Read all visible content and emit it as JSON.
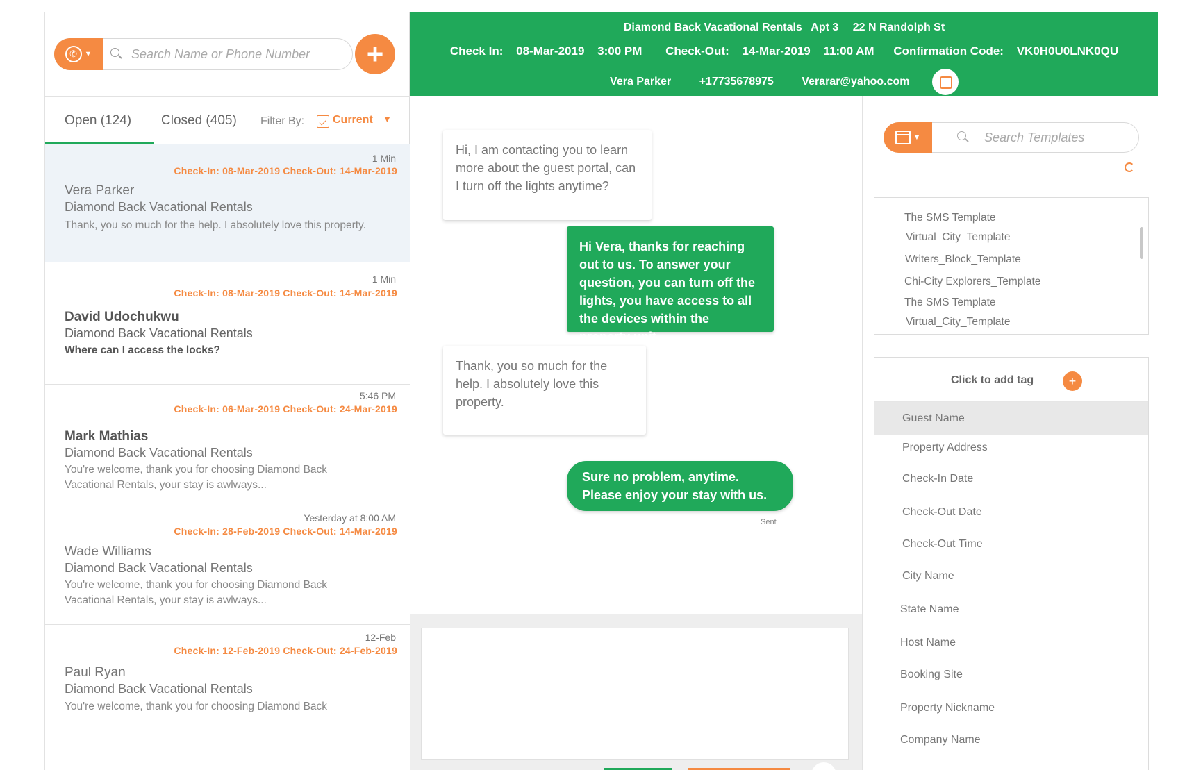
{
  "left": {
    "search_placeholder": "Search Name or Phone Number",
    "add_label": "+",
    "tabs": {
      "open": "Open (124)",
      "closed": "Closed (405)"
    },
    "filter": {
      "label": "Filter By:",
      "value": "Current"
    },
    "conversations": [
      {
        "time": "1 Min",
        "dates": "Check-In: 08-Mar-2019  Check-Out: 14-Mar-2019",
        "name": "Vera Parker",
        "property": "Diamond Back Vacational Rentals",
        "message": "Thank, you so much for the help. I absolutely love this property."
      },
      {
        "time": "1 Min",
        "dates": "Check-In: 08-Mar-2019  Check-Out: 14-Mar-2019",
        "name": "David Udochukwu",
        "property": "Diamond Back Vacational Rentals",
        "message": "Where can I access the locks?"
      },
      {
        "time": "5:46 PM",
        "dates": "Check-In: 06-Mar-2019  Check-Out: 24-Mar-2019",
        "name": "Mark Mathias",
        "property": "Diamond Back Vacational Rentals",
        "message": "You're welcome, thank you for choosing Diamond Back Vacational Rentals, your stay is awlways..."
      },
      {
        "time": "Yesterday at 8:00 AM",
        "dates": "Check-In: 28-Feb-2019  Check-Out: 14-Mar-2019",
        "name": "Wade Williams",
        "property": "Diamond Back Vacational Rentals",
        "message": "You're welcome, thank you for choosing Diamond Back Vacational Rentals, your stay is awlways..."
      },
      {
        "time": "12-Feb",
        "dates": "Check-In: 12-Feb-2019  Check-Out: 24-Feb-2019",
        "name": "Paul Ryan",
        "property": "Diamond Back Vacational Rentals",
        "message": "You're welcome, thank you for choosing Diamond Back"
      }
    ]
  },
  "header": {
    "property": "Diamond Back Vacational Rentals",
    "apt": "Apt 3",
    "address": "22 N Randolph St",
    "checkin_label": "Check In:",
    "checkin_date": "08-Mar-2019",
    "checkin_time": "3:00 PM",
    "checkout_label": "Check-Out:",
    "checkout_date": "14-Mar-2019",
    "checkout_time": "11:00 AM",
    "confirmation_label": "Confirmation Code:",
    "confirmation_code": "VK0H0U0LNK0QU",
    "guest_name": "Vera Parker",
    "guest_phone": "+17735678975",
    "guest_email": "Verarar@yahoo.com"
  },
  "chat": {
    "messages": [
      {
        "direction": "in",
        "text": "Hi, I am contacting you to learn more about the guest portal, can I turn off the lights anytime?"
      },
      {
        "direction": "out",
        "text": "Hi Vera, thanks for reaching out to us. To answer your question, you can turn off the lights, you have access to all the devices within the property unit."
      },
      {
        "direction": "in",
        "text": "Thank, you so much for the help. I absolutely love this property."
      },
      {
        "direction": "out",
        "text": "Sure no problem, anytime. Please enjoy your stay with us."
      }
    ],
    "sent_label": "Sent"
  },
  "right": {
    "search_placeholder": "Search Templates",
    "templates": [
      "The SMS Template",
      "Virtual_City_Template",
      "Writers_Block_Template",
      "Chi-City Explorers_Template",
      "The SMS Template",
      "Virtual_City_Template"
    ],
    "tag_label": "Click to add tag",
    "tag_add": "+",
    "tags": [
      "Guest Name",
      "Property Address",
      "Check-In Date",
      "Check-Out Date",
      "Check-Out Time",
      "City Name",
      "State Name",
      "Host Name",
      "Booking Site",
      "Property Nickname",
      "Company Name"
    ]
  },
  "colors": {
    "green": "#20a95a",
    "orange": "#f58a42"
  },
  "icons": [
    "phone-icon",
    "search-icon",
    "add-icon",
    "calendar-icon",
    "filter-calendar-icon",
    "spinner-icon",
    "guest-portal-icon"
  ]
}
